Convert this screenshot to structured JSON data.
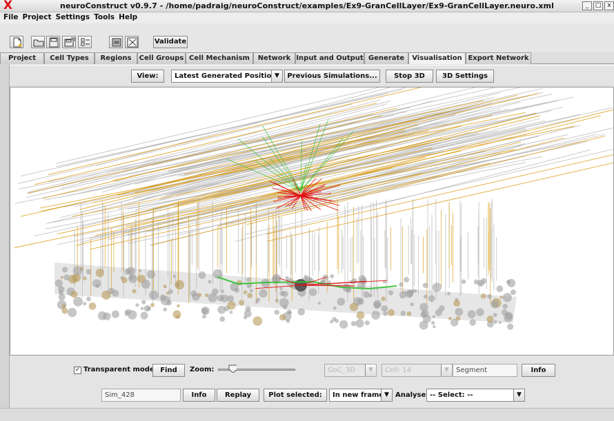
{
  "window": {
    "title": "neuroConstruct v0.9.7 - /home/padraig/neuroConstruct/examples/Ex9-GranCellLayer/Ex9-GranCellLayer.neuro.xml",
    "minimize": "_",
    "maximize": "□",
    "close": "x"
  },
  "menu": [
    "File",
    "Project",
    "Settings",
    "Tools",
    "Help"
  ],
  "toolbar": {
    "validate_label": "Validate",
    "icons": [
      "new-project-icon",
      "open-project-icon",
      "save-project-icon",
      "save-as-icon",
      "options-icon",
      "zip-icon",
      "close-project-icon"
    ]
  },
  "tabs": [
    "Project",
    "Cell Types",
    "Regions",
    "Cell Groups",
    "Cell Mechanism",
    "Network",
    "Input and Output",
    "Generate",
    "Visualisation",
    "Export Network"
  ],
  "active_tab": "Visualisation",
  "view_bar": {
    "view_label": "View:",
    "view_selected": "Latest Generated Positions",
    "previous_sims": "Previous Simulations...",
    "stop_3d": "Stop 3D",
    "settings_3d": "3D Settings"
  },
  "controls": {
    "transparent_mode_label": "Transparent mode",
    "transparent_mode_checked": true,
    "find_label": "Find",
    "zoom_label": "Zoom:",
    "zoom_level": 0.2,
    "cell_group_select": "GoC_3D",
    "cell_select": "Cell: 14",
    "segment_field": "Segment",
    "info_label": "Info"
  },
  "simulation": {
    "sim_name": "Sim_428",
    "info_label": "Info",
    "replay_label": "Replay",
    "plot_selected_label": "Plot selected:",
    "plot_target": "In new frame",
    "analyse_label": "Analyse:",
    "analyse_select": "-- Select: --"
  },
  "colors": {
    "gray_fibers": "#b4b4b4",
    "orange_fibers": "#dca020",
    "green_axons": "#30c030",
    "red_synapses": "#e01010",
    "layer_plane": "#cfcfcf"
  }
}
